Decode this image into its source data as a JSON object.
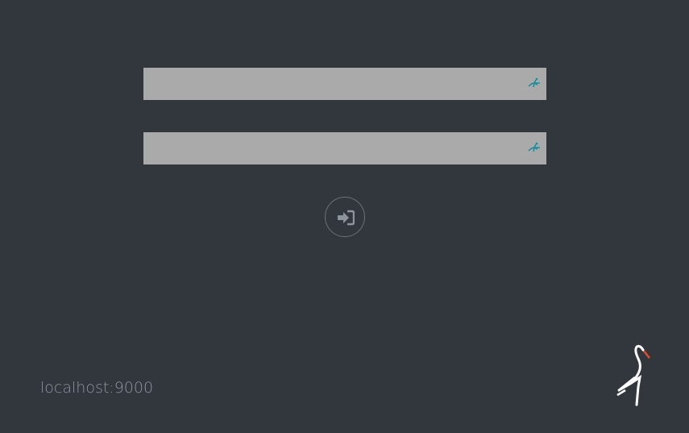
{
  "login": {
    "access_key_value": "",
    "secret_key_value": "",
    "access_key_icon": "password-manager-icon",
    "secret_key_icon": "password-manager-icon",
    "submit_icon": "sign-in-icon"
  },
  "footer": {
    "host": "localhost:9000",
    "logo": "heron-logo-icon"
  },
  "colors": {
    "background": "#32373e",
    "field": "#aaaaaa",
    "accent": "#1a8b9d",
    "logo_beak": "#e64a2e"
  }
}
